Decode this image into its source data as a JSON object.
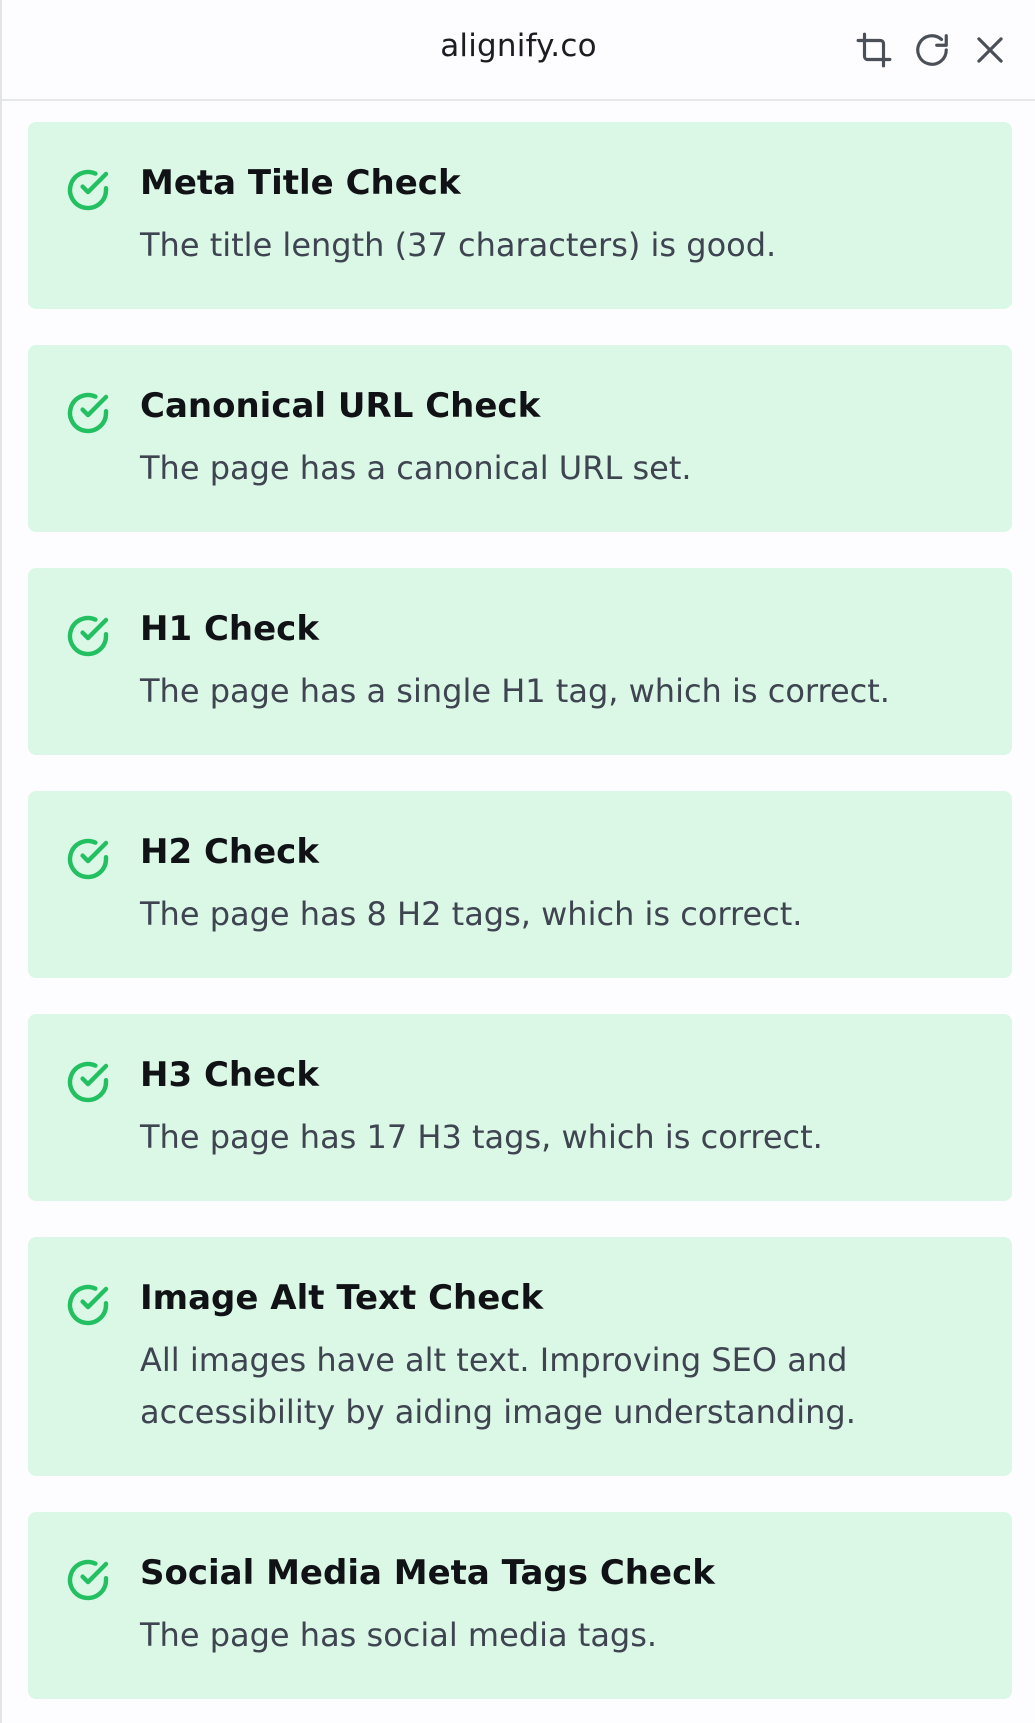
{
  "header": {
    "title": "alignify.co",
    "icons": [
      "crop-icon",
      "refresh-icon",
      "close-icon"
    ]
  },
  "colors": {
    "card_bg": "#dbf7e6",
    "check_green": "#22c061"
  },
  "checks": [
    {
      "title": "Meta Title Check",
      "description": "The title length (37 characters) is good."
    },
    {
      "title": "Canonical URL Check",
      "description": "The page has a canonical URL set."
    },
    {
      "title": "H1 Check",
      "description": "The page has a single H1 tag, which is correct."
    },
    {
      "title": "H2 Check",
      "description": "The page has 8 H2 tags, which is correct."
    },
    {
      "title": "H3 Check",
      "description": "The page has 17 H3 tags, which is correct."
    },
    {
      "title": "Image Alt Text Check",
      "description": "All images have alt text. Improving SEO and accessibility by aiding image understanding."
    },
    {
      "title": "Social Media Meta Tags Check",
      "description": "The page has social media tags."
    }
  ]
}
